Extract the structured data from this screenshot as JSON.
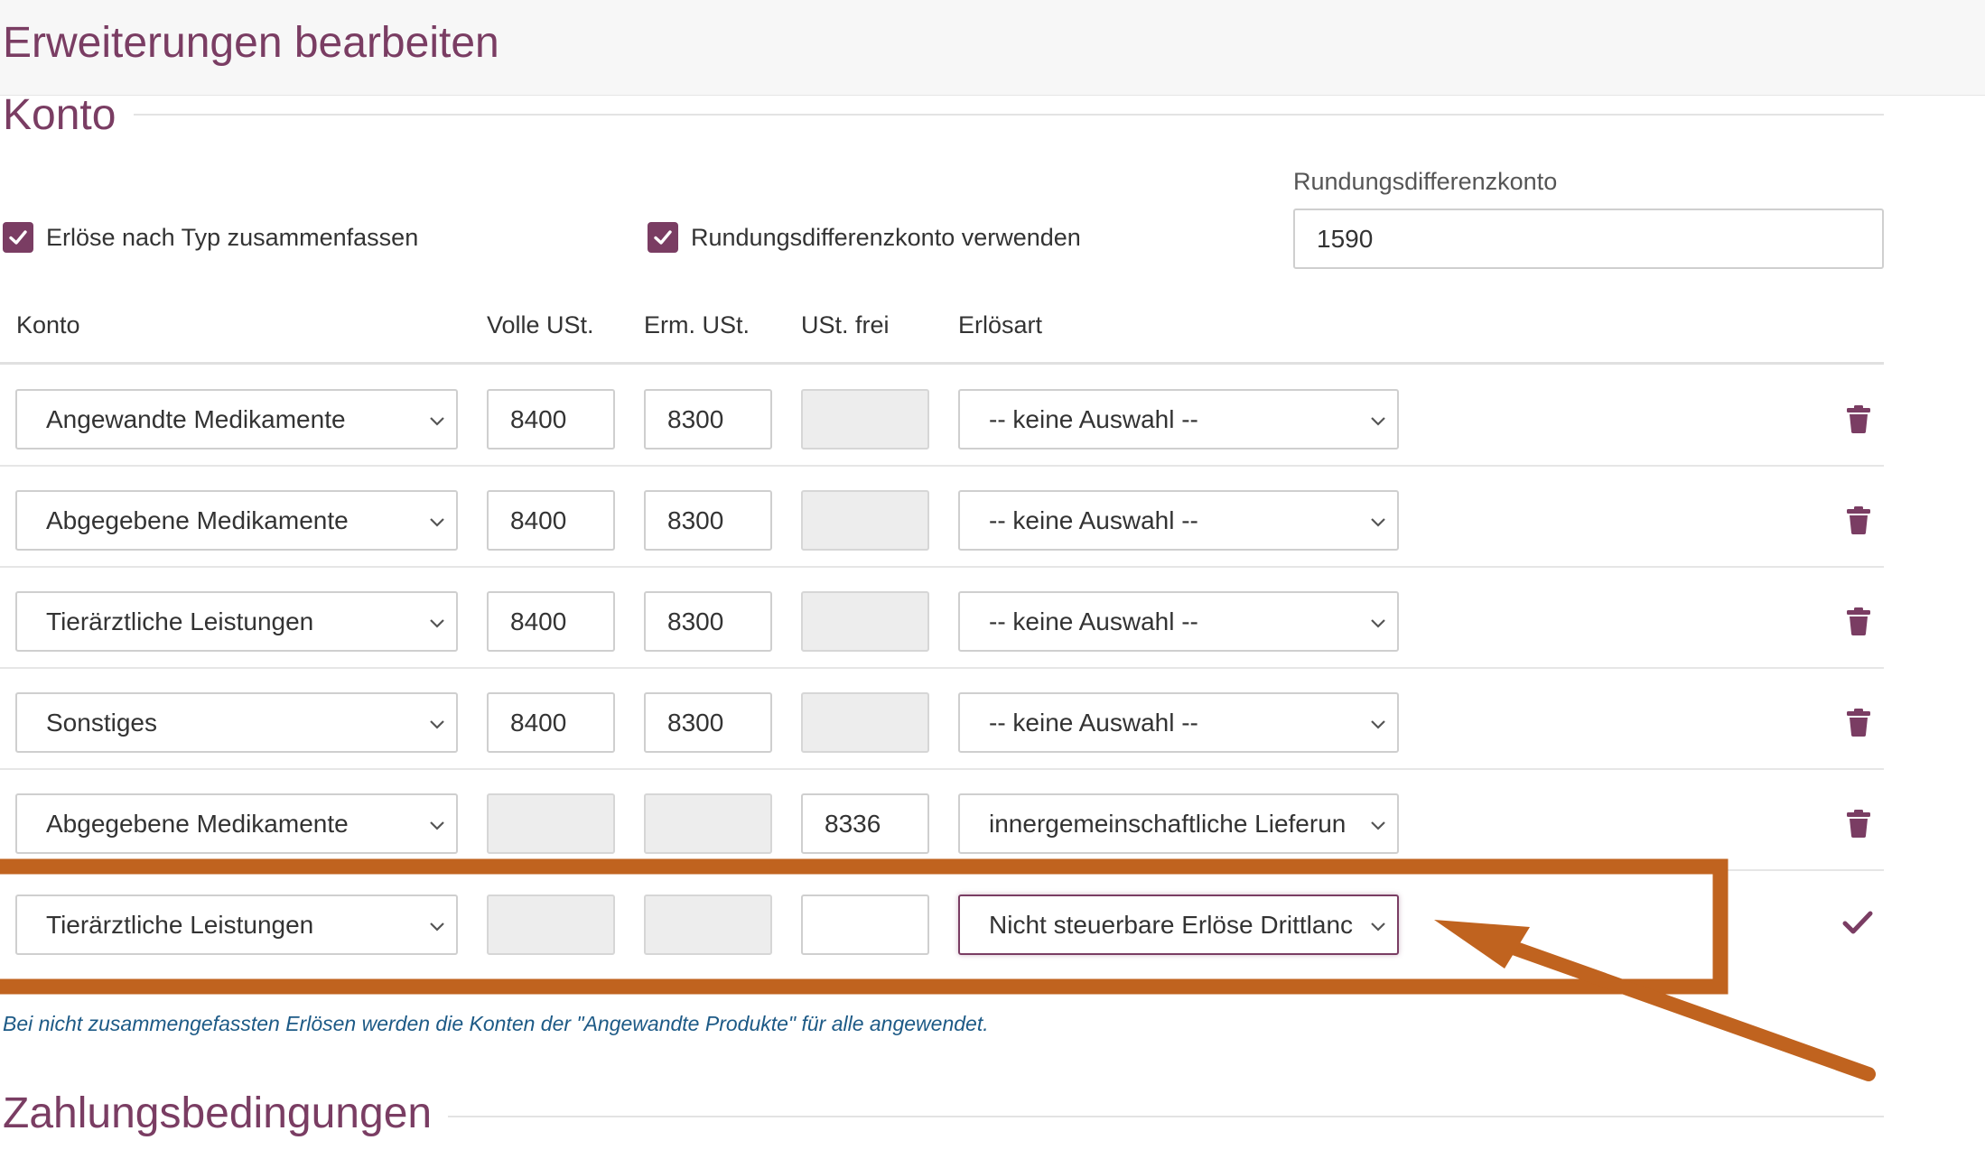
{
  "page": {
    "title": "Erweiterungen bearbeiten"
  },
  "konto_section": {
    "title": "Konto",
    "combine_revenue": {
      "label": "Erlöse nach Typ zusammenfassen",
      "checked": true
    },
    "use_rounding": {
      "label": "Rundungsdifferenzkonto verwenden",
      "checked": true
    },
    "rounding_account": {
      "label": "Rundungsdifferenzkonto",
      "value": "1590"
    }
  },
  "table": {
    "columns": {
      "konto": "Konto",
      "volle_ust": "Volle USt.",
      "erm_ust": "Erm. USt.",
      "ust_frei": "USt. frei",
      "erloesart": "Erlösart"
    },
    "rows": [
      {
        "konto": "Angewandte Medikamente",
        "volle_ust": "8400",
        "erm_ust": "8300",
        "ust_frei": "",
        "erloesart": "-- keine Auswahl --",
        "action": "delete"
      },
      {
        "konto": "Abgegebene Medikamente",
        "volle_ust": "8400",
        "erm_ust": "8300",
        "ust_frei": "",
        "erloesart": "-- keine Auswahl --",
        "action": "delete"
      },
      {
        "konto": "Tierärztliche Leistungen",
        "volle_ust": "8400",
        "erm_ust": "8300",
        "ust_frei": "",
        "erloesart": "-- keine Auswahl --",
        "action": "delete"
      },
      {
        "konto": "Sonstiges",
        "volle_ust": "8400",
        "erm_ust": "8300",
        "ust_frei": "",
        "erloesart": "-- keine Auswahl --",
        "action": "delete"
      },
      {
        "konto": "Abgegebene Medikamente",
        "volle_ust": "",
        "erm_ust": "",
        "ust_frei": "8336",
        "erloesart": "innergemeinschaftliche Lieferun",
        "action": "delete"
      },
      {
        "konto": "Tierärztliche Leistungen",
        "volle_ust": "",
        "erm_ust": "",
        "ust_frei": "",
        "erloesart": "Nicht steuerbare Erlöse Drittlanc",
        "action": "confirm"
      }
    ]
  },
  "hint": "Bei nicht zusammengefassten Erlösen werden die Konten der \"Angewandte Produkte\" für alle angewendet.",
  "payment_section": {
    "title": "Zahlungsbedingungen"
  },
  "icons": {
    "checkbox": "checkmark-icon",
    "select": "chevron-down-icon",
    "delete": "trash-icon",
    "confirm": "checkmark-icon",
    "annotation": "arrow-annotation"
  },
  "colors": {
    "brand": "#7a3d63",
    "annotation": "#c0631f",
    "hint": "#1d5a86",
    "disabled_field": "#ededed"
  }
}
